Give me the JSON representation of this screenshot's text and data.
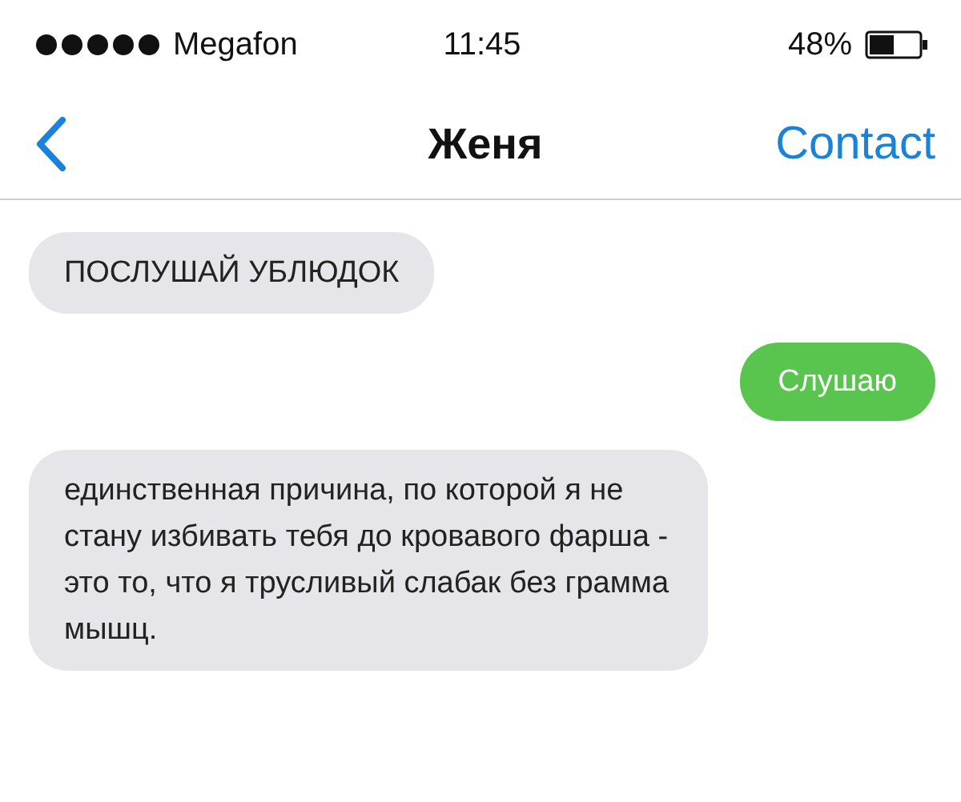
{
  "status_bar": {
    "carrier": "Megafon",
    "time": "11:45",
    "battery": "48%"
  },
  "nav": {
    "title": "Женя",
    "action": "Contact"
  },
  "messages": [
    {
      "kind": "incoming",
      "text": "ПОСЛУШАЙ УБЛЮДОК"
    },
    {
      "kind": "outgoing",
      "text": "Слушаю"
    },
    {
      "kind": "incoming",
      "text": "единственная причина, по которой я не стану избивать тебя до кровавого фарша - это то, что я трусливый слабак без грамма мышц."
    }
  ]
}
